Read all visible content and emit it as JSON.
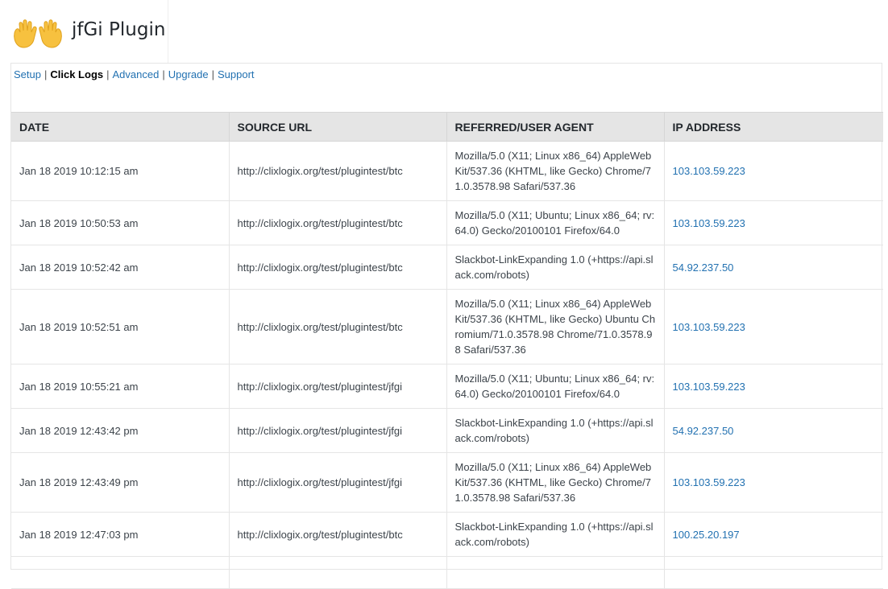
{
  "header": {
    "logo_icon": "waving-hands-icon",
    "title": "jfGi Plugin"
  },
  "nav": {
    "items": [
      {
        "label": "Setup",
        "active": false
      },
      {
        "label": "Click Logs",
        "active": true
      },
      {
        "label": "Advanced",
        "active": false
      },
      {
        "label": "Upgrade",
        "active": false
      },
      {
        "label": "Support",
        "active": false
      }
    ],
    "separator": "|"
  },
  "table": {
    "headers": [
      "DATE",
      "SOURCE URL",
      "REFERRED/USER AGENT",
      "IP ADDRESS"
    ],
    "rows": [
      {
        "date": "Jan 18 2019 10:12:15 am",
        "source": "http://clixlogix.org/test/plugintest/btc",
        "agent": "Mozilla/5.0 (X11; Linux x86_64) AppleWebKit/537.36 (KHTML, like Gecko) Chrome/71.0.3578.98 Safari/537.36",
        "ip": "103.103.59.223"
      },
      {
        "date": "Jan 18 2019 10:50:53 am",
        "source": "http://clixlogix.org/test/plugintest/btc",
        "agent": "Mozilla/5.0 (X11; Ubuntu; Linux x86_64; rv:64.0) Gecko/20100101 Firefox/64.0",
        "ip": "103.103.59.223"
      },
      {
        "date": "Jan 18 2019 10:52:42 am",
        "source": "http://clixlogix.org/test/plugintest/btc",
        "agent": "Slackbot-LinkExpanding 1.0 (+https://api.slack.com/robots)",
        "ip": "54.92.237.50"
      },
      {
        "date": "Jan 18 2019 10:52:51 am",
        "source": "http://clixlogix.org/test/plugintest/btc",
        "agent": "Mozilla/5.0 (X11; Linux x86_64) AppleWebKit/537.36 (KHTML, like Gecko) Ubuntu Chromium/71.0.3578.98 Chrome/71.0.3578.98 Safari/537.36",
        "ip": "103.103.59.223"
      },
      {
        "date": "Jan 18 2019 10:55:21 am",
        "source": "http://clixlogix.org/test/plugintest/jfgi",
        "agent": "Mozilla/5.0 (X11; Ubuntu; Linux x86_64; rv:64.0) Gecko/20100101 Firefox/64.0",
        "ip": "103.103.59.223"
      },
      {
        "date": "Jan 18 2019 12:43:42 pm",
        "source": "http://clixlogix.org/test/plugintest/jfgi",
        "agent": "Slackbot-LinkExpanding 1.0 (+https://api.slack.com/robots)",
        "ip": "54.92.237.50"
      },
      {
        "date": "Jan 18 2019 12:43:49 pm",
        "source": "http://clixlogix.org/test/plugintest/jfgi",
        "agent": "Mozilla/5.0 (X11; Linux x86_64) AppleWebKit/537.36 (KHTML, like Gecko) Chrome/71.0.3578.98 Safari/537.36",
        "ip": "103.103.59.223"
      },
      {
        "date": "Jan 18 2019 12:47:03 pm",
        "source": "http://clixlogix.org/test/plugintest/btc",
        "agent": "Slackbot-LinkExpanding 1.0 (+https://api.slack.com/robots)",
        "ip": "100.25.20.197"
      }
    ]
  },
  "colors": {
    "link": "#2271b1",
    "header_bg": "#e5e5e5",
    "text": "#3c434a"
  }
}
